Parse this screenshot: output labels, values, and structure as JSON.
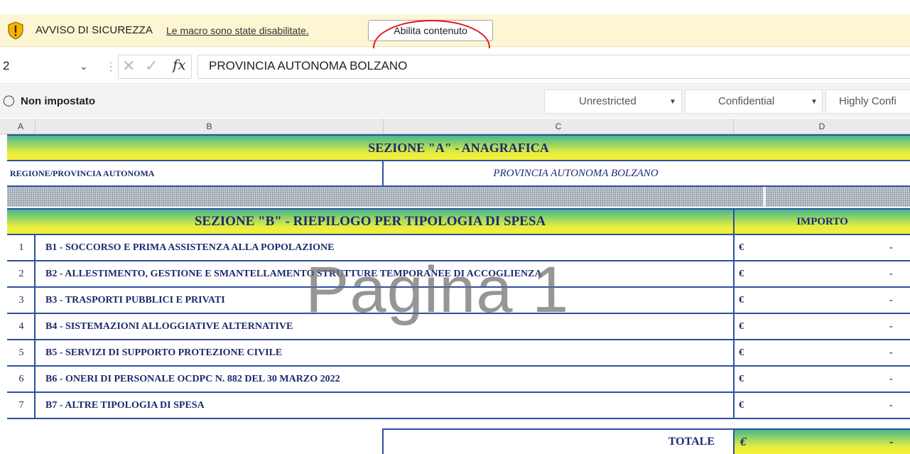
{
  "security_bar": {
    "title": "AVVISO DI SICUREZZA",
    "message": "Le macro sono state disabilitate.",
    "enable_label": "Abilita contenuto",
    "highlight_color": "#e01a1a",
    "icon": "shield-warning-icon"
  },
  "formula_bar": {
    "name_box": "2",
    "formula": "PROVINCIA AUTONOMA BOLZANO"
  },
  "sensitivity_bar": {
    "label": "Non impostato",
    "options": [
      "Unrestricted",
      "Confidential",
      "Highly Confi"
    ]
  },
  "columns": [
    "A",
    "B",
    "C",
    "D"
  ],
  "sheet": {
    "section_a_title": "SEZIONE \"A\" - ANAGRAFICA",
    "region_label": "REGIONE/PROVINCIA AUTONOMA",
    "region_value": "PROVINCIA AUTONOMA BOLZANO",
    "section_b_title": "SEZIONE \"B\" - RIEPILOGO PER TIPOLOGIA DI SPESA",
    "amount_header": "IMPORTO",
    "rows": [
      {
        "num": "1",
        "desc": "B1 - SOCCORSO E PRIMA ASSISTENZA ALLA POPOLAZIONE",
        "currency": "€",
        "amount": "-"
      },
      {
        "num": "2",
        "desc": "B2 - ALLESTIMENTO, GESTIONE E SMANTELLAMENTO STRUTTURE TEMPORANEE DI ACCOGLIENZA",
        "currency": "€",
        "amount": "-"
      },
      {
        "num": "3",
        "desc": "B3 - TRASPORTI PUBBLICI E PRIVATI",
        "currency": "€",
        "amount": "-"
      },
      {
        "num": "4",
        "desc": "B4 - SISTEMAZIONI ALLOGGIATIVE ALTERNATIVE",
        "currency": "€",
        "amount": "-"
      },
      {
        "num": "5",
        "desc": "B5 - SERVIZI DI SUPPORTO PROTEZIONE CIVILE",
        "currency": "€",
        "amount": "-"
      },
      {
        "num": "6",
        "desc": "B6 - ONERI DI PERSONALE OCDPC N. 882 DEL 30 MARZO 2022",
        "currency": "€",
        "amount": "-"
      },
      {
        "num": "7",
        "desc": "B7 - ALTRE TIPOLOGIA DI SPESA",
        "currency": "€",
        "amount": "-"
      }
    ],
    "total_label": "TOTALE",
    "total_currency": "€",
    "total_amount": "-"
  },
  "watermark": "Pagina 1",
  "colors": {
    "border": "#2f4f9e",
    "text": "#1c2a6e",
    "band_green": "#45b98e",
    "band_yellow": "#f2f138"
  }
}
